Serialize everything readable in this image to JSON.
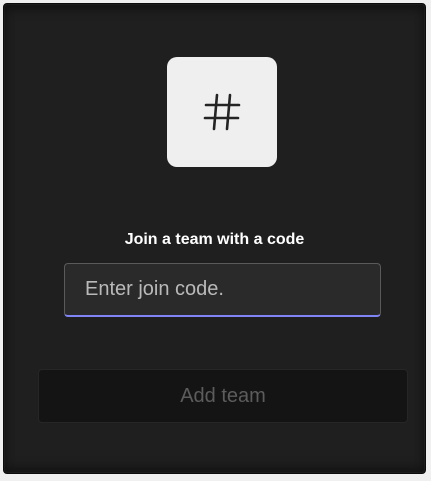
{
  "join_card": {
    "icon": "hash-icon",
    "title": "Join a team with a code",
    "code_input": {
      "value": "",
      "placeholder": "Enter join code."
    },
    "add_button": {
      "label": "Add team",
      "state": "disabled"
    }
  },
  "colors": {
    "card_background": "#1f1f1f",
    "icon_tile": "#efefef",
    "input_focus_underline": "#7f85f5",
    "disabled_button_bg": "#141414",
    "disabled_button_text": "#5c5c5c"
  }
}
